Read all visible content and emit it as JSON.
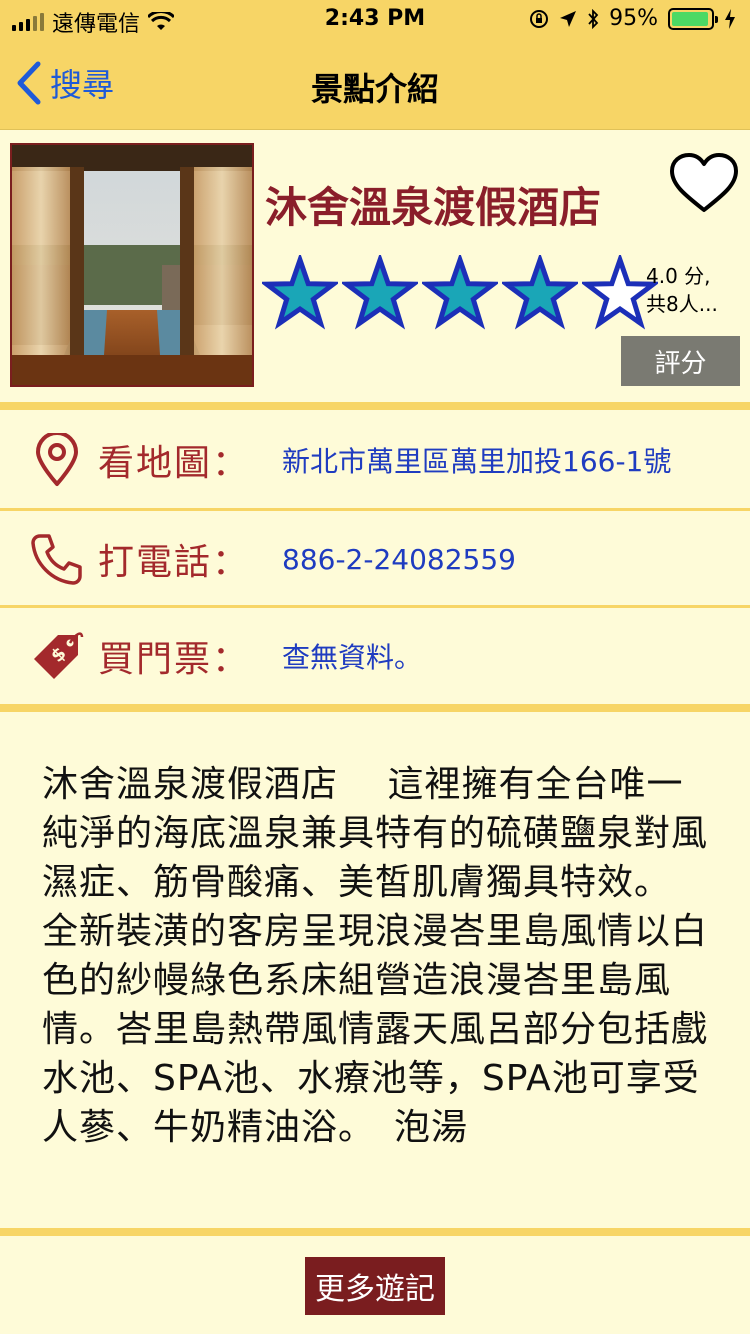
{
  "status_bar": {
    "carrier": "遠傳電信",
    "time": "2:43 PM",
    "battery": "95%",
    "battery_level": 0.95
  },
  "nav": {
    "back_label": "搜尋",
    "title": "景點介紹"
  },
  "hotel": {
    "name": "沐舍溫泉渡假酒店",
    "rating_line1": "4.0 分,",
    "rating_line2": "共8人...",
    "rating_value": 4,
    "rating_max": 5,
    "rate_button": "評分",
    "favorite_icon": "heart-outline-icon"
  },
  "info": {
    "map_label": "看地圖：",
    "address": "新北市萬里區萬里加投166-1號",
    "phone_label": "打電話：",
    "phone": "886-2-24082559",
    "ticket_label": "買門票：",
    "ticket": "查無資料。"
  },
  "description": "沐舍溫泉渡假酒店　 這裡擁有全台唯一純淨的海底溫泉兼具特有的硫磺鹽泉對風濕症、筋骨酸痛、美皙肌膚獨具特效。　 全新裝潢的客房呈現浪漫峇里島風情以白色的紗幔綠色系床組營造浪漫峇里島風情。峇里島熱帶風情露天風呂部分包括戲水池、SPA池、水療池等，SPA池可享受人蔘、牛奶精油浴。　泡湯",
  "more_button": "更多遊記",
  "colors": {
    "bar": "#f7d566",
    "background": "#fefbd8",
    "title_red": "#8a1e2a",
    "label_red": "#a3292c",
    "link_blue": "#1f3cc0",
    "star_fill": "#1aa6b7",
    "star_stroke": "#1c2fb8"
  }
}
